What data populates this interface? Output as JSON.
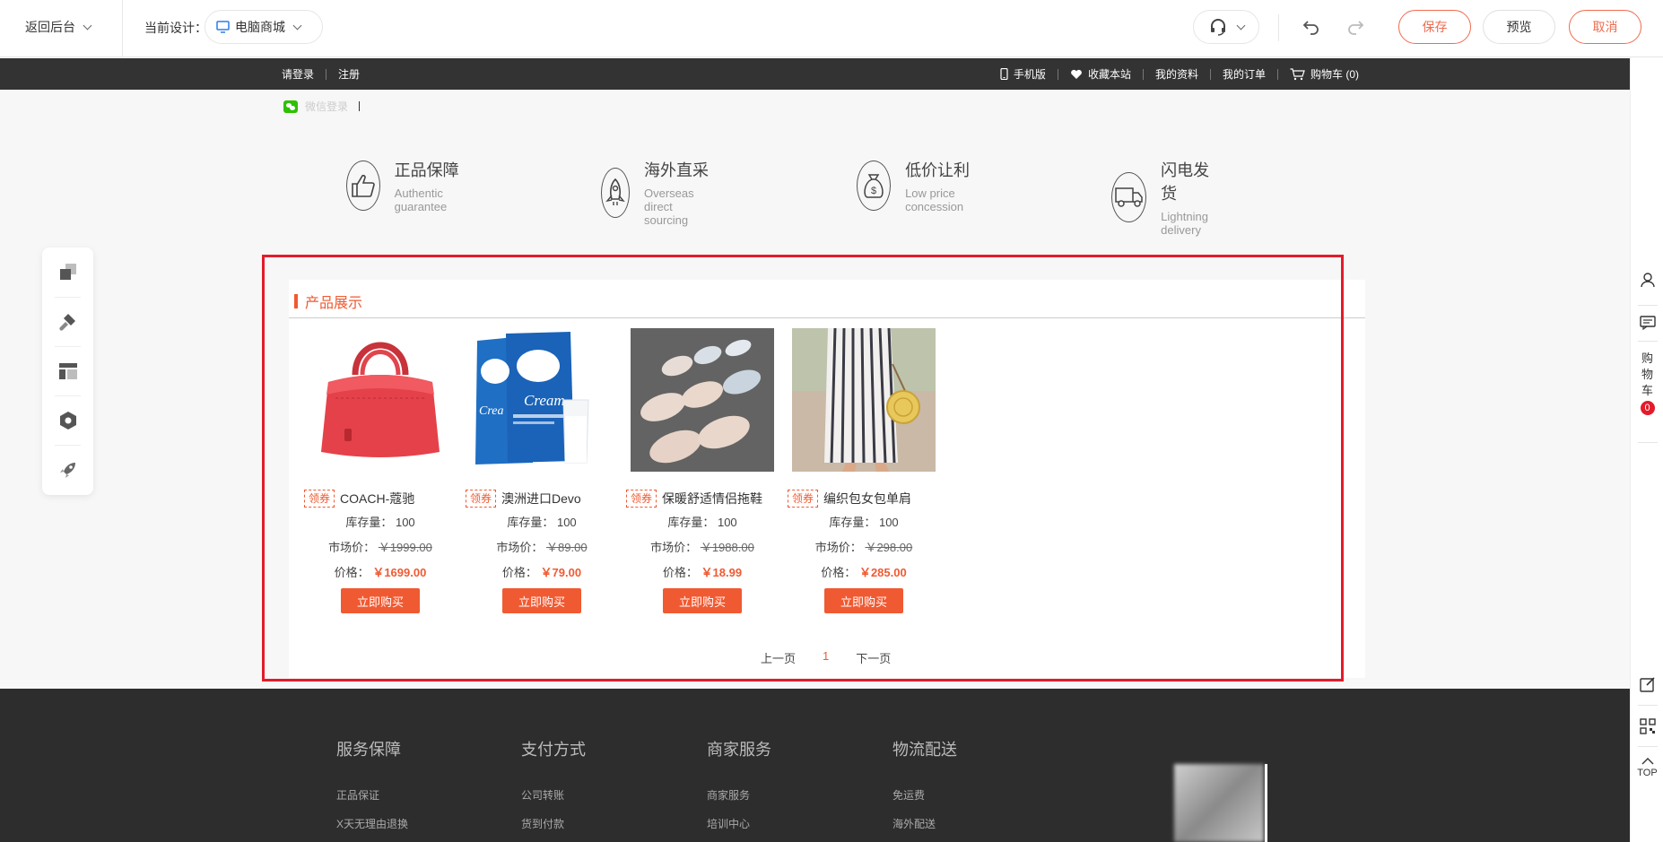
{
  "editor": {
    "back_label": "返回后台",
    "design_label": "当前设计：",
    "design_value": "电脑商城",
    "save_label": "保存",
    "preview_label": "预览",
    "cancel_label": "取消"
  },
  "site_nav": {
    "login": "请登录",
    "register": "注册",
    "mobile": "手机版",
    "favorite": "收藏本站",
    "profile": "我的资料",
    "orders": "我的订单",
    "cart": "购物车 (0)"
  },
  "wechat_login": "微信登录",
  "features": [
    {
      "zh": "正品保障",
      "en": "Authentic guarantee",
      "icon": "thumbs-up-icon"
    },
    {
      "zh": "海外直采",
      "en": "Overseas direct sourcing",
      "icon": "rocket-icon"
    },
    {
      "zh": "低价让利",
      "en": "Low price concession",
      "icon": "money-bag-icon"
    },
    {
      "zh": "闪电发货",
      "en": "Lightning delivery",
      "icon": "truck-icon"
    }
  ],
  "module": {
    "title": "产品展示",
    "coupon_label": "领券",
    "stock_label": "库存量：",
    "market_label": "市场价：",
    "price_label": "价格：",
    "buy_label": "立即购买",
    "products": [
      {
        "name": "COACH-蔻驰",
        "stock": "100",
        "market": "￥1999.00",
        "price": "￥1699.00",
        "image": "red-handbag"
      },
      {
        "name": "澳洲进口Devo",
        "stock": "100",
        "market": "￥89.00",
        "price": "￥79.00",
        "image": "milk-powder"
      },
      {
        "name": "保暖舒适情侣拖鞋",
        "stock": "100",
        "market": "￥1988.00",
        "price": "￥18.99",
        "image": "slippers"
      },
      {
        "name": "编织包女包单肩",
        "stock": "100",
        "market": "￥298.00",
        "price": "￥285.00",
        "image": "woven-bag"
      }
    ],
    "pager": {
      "prev": "上一页",
      "current": "1",
      "next": "下一页"
    }
  },
  "footer": {
    "columns": [
      {
        "title": "服务保障",
        "items": [
          "正品保证",
          "X天无理由退换"
        ]
      },
      {
        "title": "支付方式",
        "items": [
          "公司转账",
          "货到付款"
        ]
      },
      {
        "title": "商家服务",
        "items": [
          "商家服务",
          "培训中心"
        ]
      },
      {
        "title": "物流配送",
        "items": [
          "免运费",
          "海外配送"
        ]
      }
    ]
  },
  "right_rail": {
    "cart_text": "购物车",
    "cart_count": "0",
    "top_label": "TOP"
  },
  "colors": {
    "accent": "#f05a32",
    "highlight": "#e31b2a",
    "nav_bg": "#333333",
    "footer_bg": "#2d2d2d"
  }
}
